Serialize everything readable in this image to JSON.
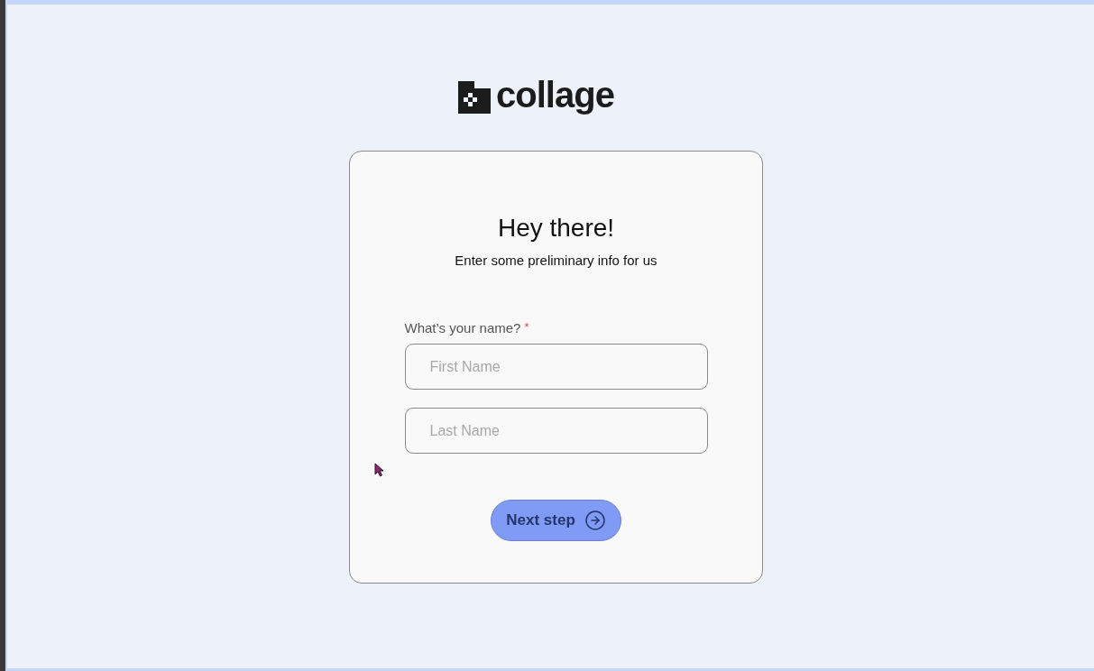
{
  "logo": {
    "text": "collage"
  },
  "card": {
    "title": "Hey there!",
    "subtitle": "Enter some preliminary info for us",
    "field_label": "What’s your name?",
    "required": true,
    "required_mark": "*",
    "fields": [
      {
        "placeholder": "First Name"
      },
      {
        "placeholder": "Last Name"
      }
    ],
    "button": "Next step"
  }
}
